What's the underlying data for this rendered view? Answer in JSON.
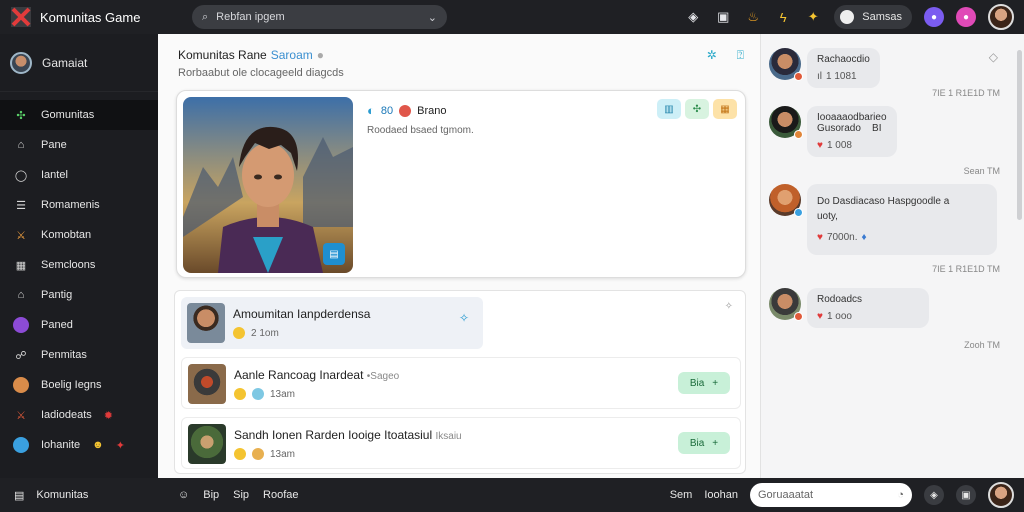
{
  "app": {
    "title": "Komunitas Game"
  },
  "search": {
    "placeholder": "Rebfan ipgem"
  },
  "topbar": {
    "pill_label": "Samsas"
  },
  "sidebar": {
    "user_name": "Gamaiat",
    "items": [
      {
        "label": "Gomunitas",
        "icon": "puzzle-icon"
      },
      {
        "label": "Pane",
        "icon": "home-icon"
      },
      {
        "label": "Iantel",
        "icon": "circle-icon"
      },
      {
        "label": "Romamenis",
        "icon": "list-icon"
      },
      {
        "label": "Komobtan",
        "icon": "sword-icon"
      },
      {
        "label": "Semcloons",
        "icon": "grid-icon"
      },
      {
        "label": "Pantig",
        "icon": "home-icon"
      },
      {
        "label": "Paned",
        "icon": "avatar"
      },
      {
        "label": "Penmitas",
        "icon": "people-icon"
      },
      {
        "label": "Boelig Iegns",
        "icon": "avatar"
      },
      {
        "label": "Iadiodeats",
        "icon": "sword-icon"
      },
      {
        "label": "Iohanite",
        "icon": "avatar"
      }
    ]
  },
  "main": {
    "title": "Komunitas Rane",
    "title_accent": "Saroam",
    "subtitle": "Rorbaabut ole clocageeld diagcds"
  },
  "hero": {
    "tag_num": "80",
    "tag_label": "Brano",
    "description": "Roodaed bsaed tgmom."
  },
  "list": {
    "rows": [
      {
        "title": "Amoumitan Ianpderdensa",
        "meta": "2 1om"
      },
      {
        "title": "Aanle Rancoag Inardeat",
        "title_muted": "•Sageo",
        "meta": "13am",
        "btn": "Bia"
      },
      {
        "title": "Sandh Ionen Rarden Iooige Itoatasiul",
        "title_muted": "Iksaiu",
        "meta": "13am",
        "btn": "Bia"
      }
    ]
  },
  "chat": {
    "messages": [
      {
        "line1": "Rachaocdio",
        "line2": "1 1081",
        "time": ""
      },
      {
        "line1": "Iooaaaodbarieo",
        "line2": "Gusorado",
        "line2b": "BI",
        "line3": "1 008",
        "time": "7IE 1 R1E1D TM"
      },
      {
        "line1": "Do Dasdiacaso Haspgoodle a",
        "line2": "uoty,",
        "line3": "7000n.",
        "time": "Sean TM"
      },
      {
        "line1": "Rodoadcs",
        "line2": "1 ooo",
        "time": "7IE 1 R1E1D TM"
      }
    ],
    "time_last": "Zooh TM"
  },
  "bottombar": {
    "left_label": "Komunitas",
    "mid": [
      "Bip",
      "Sip",
      "Roofae"
    ],
    "right": [
      "Sem",
      "Ioohan"
    ],
    "input_placeholder": "Goruaaatat"
  }
}
